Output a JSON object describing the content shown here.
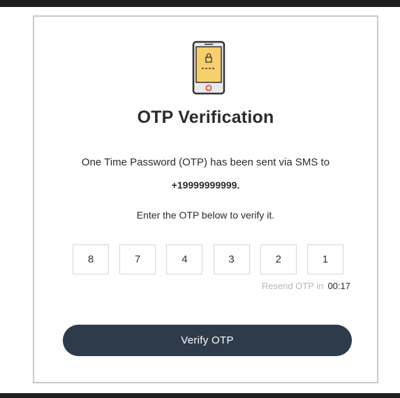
{
  "card": {
    "title": "OTP Verification",
    "info_text": "One Time Password (OTP) has been sent via SMS to",
    "phone_number": "+19999999999.",
    "instruction": "Enter the OTP below to verify it."
  },
  "otp": {
    "digits": [
      "8",
      "7",
      "4",
      "3",
      "2",
      "1"
    ]
  },
  "resend": {
    "label": "Resend OTP in",
    "timer": "00:17"
  },
  "verify_button": {
    "label": "Verify OTP"
  },
  "icons": {
    "illustration": "phone-with-lock-icon"
  },
  "colors": {
    "button_bg": "#2d3b4a",
    "phone_screen": "#f7cf6b",
    "card_border": "#c9c9c9",
    "muted_text": "#b7b7b7"
  }
}
